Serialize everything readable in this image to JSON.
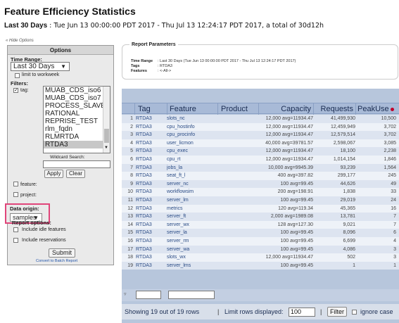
{
  "page": {
    "title": "Feature Efficiency Statistics",
    "range_label": "Last 30 Days",
    "range_text": " : Tue Jun 13 00:00:00 PDT 2017 - Thu Jul 13 12:24:17 PDT 2017, a total of 30d12h",
    "hide_options": "« Hide Options"
  },
  "options": {
    "header": "Options",
    "time_range_label": "Time Range:",
    "time_range_value": "Last 30 Days",
    "limit_workweek": "limit to workweek",
    "filters_label": "Filters:",
    "tag_label": "tag:",
    "tag_items": [
      "MUAB_CDS_iso6",
      "MUAB_CDS_iso7",
      "PROCESS_SLAVE",
      "RATIONAL",
      "REPRISE_TEST",
      "rlm_fqdn",
      "RLMRTDA",
      "RTDA3"
    ],
    "wildcard_label": "Wildcard Search:",
    "apply": "Apply",
    "clear": "Clear",
    "feature_label": "feature:",
    "project_label": "project:",
    "data_origin_label": "Data origin:",
    "data_origin_value": "samples",
    "report_options_label": "Report options:",
    "include_idle": "Include idle features",
    "include_reservations": "Include reservations",
    "submit": "Submit",
    "batch_link": "Convert to Batch Report"
  },
  "params": {
    "title": "Report Parameters",
    "rows": [
      {
        "k": "Time Range",
        "v": ": Last 30 Days (Tue Jun 13 00:00:00 PDT 2017 - Thu Jul 13 12:24:17 PDT 2017)"
      },
      {
        "k": "Tags",
        "v": ": RTDA3"
      },
      {
        "k": "Features",
        "v": ": <-All->"
      }
    ]
  },
  "table": {
    "columns": [
      "Tag",
      "Feature",
      "Product",
      "Capacity",
      "Requests",
      "PeakUse"
    ],
    "rows": [
      [
        "1",
        "RTDA3",
        "slots_nc",
        "",
        "12,000 avg=11934.47",
        "41,499,930",
        "10,500"
      ],
      [
        "2",
        "RTDA3",
        "cpu_hostinfo",
        "",
        "12,000 avg=11934.47",
        "12,459,949",
        "3,702"
      ],
      [
        "3",
        "RTDA3",
        "cpu_procinfo",
        "",
        "12,000 avg=11934.47",
        "12,579,514",
        "3,702"
      ],
      [
        "4",
        "RTDA3",
        "user_licmon",
        "",
        "40,000 avg=39781.57",
        "2,598,067",
        "3,085"
      ],
      [
        "5",
        "RTDA3",
        "cpu_exec",
        "",
        "12,000 avg=11934.47",
        "18,100",
        "2,238"
      ],
      [
        "6",
        "RTDA3",
        "cpu_rt",
        "",
        "12,000 avg=11934.47",
        "1,014,154",
        "1,846"
      ],
      [
        "7",
        "RTDA3",
        "jobs_la",
        "",
        "10,000 avg=9945.39",
        "93,239",
        "1,564"
      ],
      [
        "8",
        "RTDA3",
        "seat_ft_l",
        "",
        "400 avg=397.82",
        "299,177",
        "245"
      ],
      [
        "9",
        "RTDA3",
        "server_nc",
        "",
        "100 avg=99.45",
        "44,626",
        "49"
      ],
      [
        "10",
        "RTDA3",
        "workflowsim",
        "",
        "200 avg=198.91",
        "1,838",
        "33"
      ],
      [
        "11",
        "RTDA3",
        "server_lm",
        "",
        "100 avg=99.45",
        "29,019",
        "24"
      ],
      [
        "12",
        "RTDA3",
        "metrics",
        "",
        "120 avg=119.34",
        "45,365",
        "16"
      ],
      [
        "13",
        "RTDA3",
        "server_ft",
        "",
        "2,000 avg=1989.08",
        "13,781",
        "7"
      ],
      [
        "14",
        "RTDA3",
        "server_wx",
        "",
        "128 avg=127.30",
        "9,021",
        "7"
      ],
      [
        "15",
        "RTDA3",
        "server_la",
        "",
        "100 avg=99.45",
        "8,096",
        "6"
      ],
      [
        "16",
        "RTDA3",
        "server_rm",
        "",
        "100 avg=99.45",
        "6,699",
        "4"
      ],
      [
        "17",
        "RTDA3",
        "server_wa",
        "",
        "100 avg=99.45",
        "4,086",
        "3"
      ],
      [
        "18",
        "RTDA3",
        "slots_wx",
        "",
        "12,000 avg=11934.47",
        "502",
        "3"
      ],
      [
        "19",
        "RTDA3",
        "server_lms",
        "",
        "100 avg=99.45",
        "1",
        "1"
      ]
    ],
    "footer_showing": "Showing 19 out of 19 rows",
    "footer_limit": "Limit rows displayed:",
    "limit_value": "100",
    "filter_btn": "Filter",
    "ignore_case": "ignore case"
  },
  "colors": {
    "highlight": "#e0457a",
    "header_bg": "#a8bad7",
    "peak_dot": "#c0002a"
  }
}
